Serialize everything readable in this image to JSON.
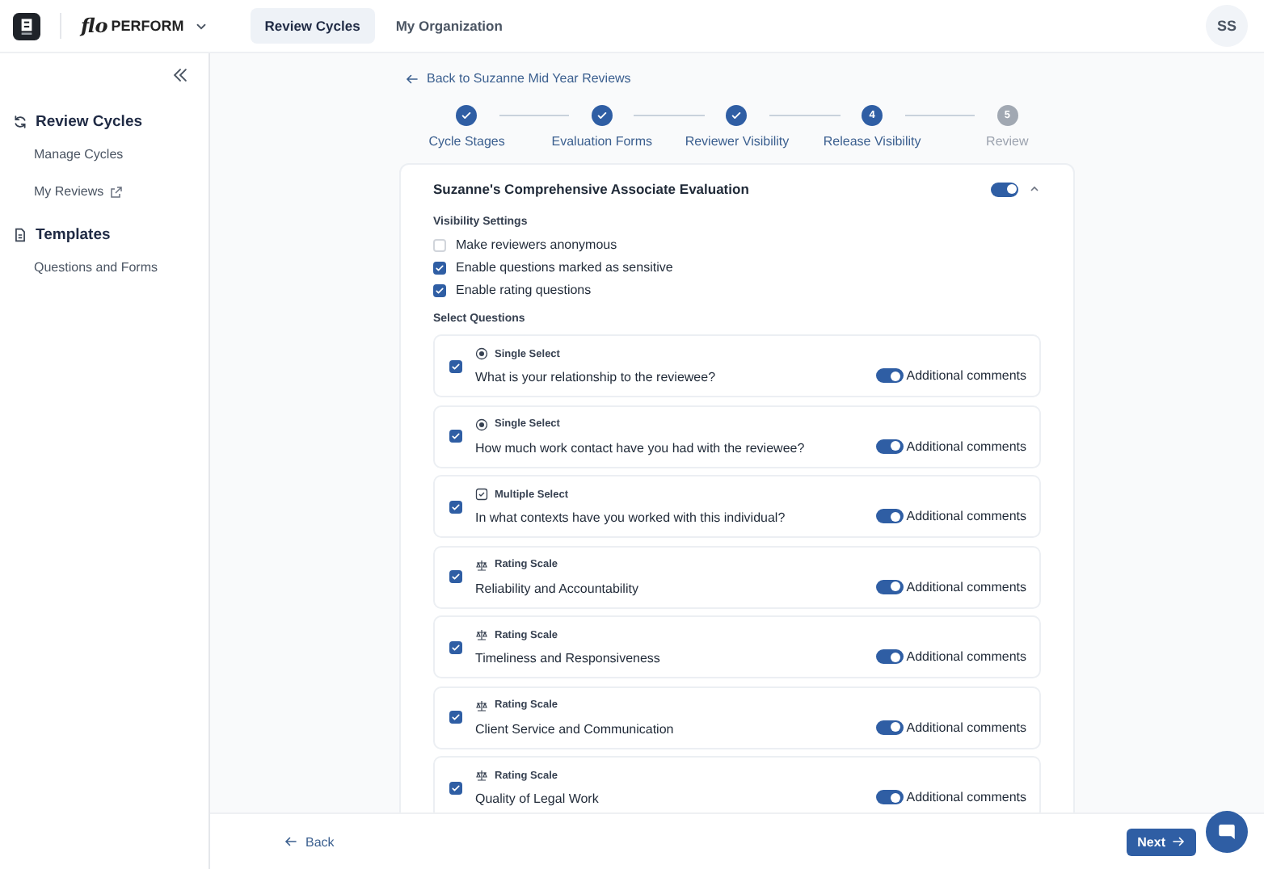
{
  "header": {
    "brand_script": "flo",
    "brand_name": "PERFORM",
    "nav": [
      {
        "label": "Review Cycles",
        "selected": true
      },
      {
        "label": "My Organization",
        "selected": false
      }
    ],
    "avatar": "SS"
  },
  "sidebar": {
    "sections": [
      {
        "kind": "cycles",
        "label": "Review Cycles",
        "items": [
          {
            "label": "Manage Cycles"
          },
          {
            "label": "My Reviews",
            "external": true
          }
        ]
      },
      {
        "kind": "templates",
        "label": "Templates",
        "items": [
          {
            "label": "Questions and Forms"
          }
        ]
      }
    ]
  },
  "back_link": "Back to Suzanne Mid Year Reviews",
  "steps": [
    {
      "label": "Cycle Stages",
      "done": true,
      "selected": false
    },
    {
      "label": "Evaluation Forms",
      "done": true,
      "selected": false
    },
    {
      "label": "Reviewer Visibility",
      "done": true,
      "selected": false
    },
    {
      "number": "4",
      "label": "Release Visibility",
      "done": false,
      "selected": true
    },
    {
      "number": "5",
      "label": "Review",
      "done": false,
      "selected": false
    }
  ],
  "form": {
    "title": "Suzanne's Comprehensive Associate Evaluation",
    "on": true,
    "expanded": true,
    "settings_heading": "Visibility Settings",
    "settings": [
      {
        "label": "Make reviewers anonymous",
        "checked": false
      },
      {
        "label": "Enable questions marked as sensitive",
        "checked": true
      },
      {
        "label": "Enable rating questions",
        "checked": true
      }
    ],
    "questions_heading": "Select Questions",
    "questions": [
      {
        "kind": "single",
        "type": "Single Select",
        "text": "What is your relationship to the reviewee?",
        "checked": true,
        "comments_on": true,
        "comments_label": "Additional comments"
      },
      {
        "kind": "single",
        "type": "Single Select",
        "text": "How much work contact have you had with the reviewee?",
        "checked": true,
        "comments_on": true,
        "comments_label": "Additional comments"
      },
      {
        "kind": "multiple",
        "type": "Multiple Select",
        "text": "In what contexts have you worked with this individual?",
        "checked": true,
        "comments_on": true,
        "comments_label": "Additional comments"
      },
      {
        "kind": "rating",
        "type": "Rating Scale",
        "text": "Reliability and Accountability",
        "checked": true,
        "comments_on": true,
        "comments_label": "Additional comments"
      },
      {
        "kind": "rating",
        "type": "Rating Scale",
        "text": "Timeliness and Responsiveness",
        "checked": true,
        "comments_on": true,
        "comments_label": "Additional comments"
      },
      {
        "kind": "rating",
        "type": "Rating Scale",
        "text": "Client Service and Communication",
        "checked": true,
        "comments_on": true,
        "comments_label": "Additional comments"
      },
      {
        "kind": "rating",
        "type": "Rating Scale",
        "text": "Quality of Legal Work",
        "checked": true,
        "comments_on": true,
        "comments_label": "Additional comments"
      }
    ]
  },
  "footer": {
    "back": "Back",
    "next": "Next"
  }
}
